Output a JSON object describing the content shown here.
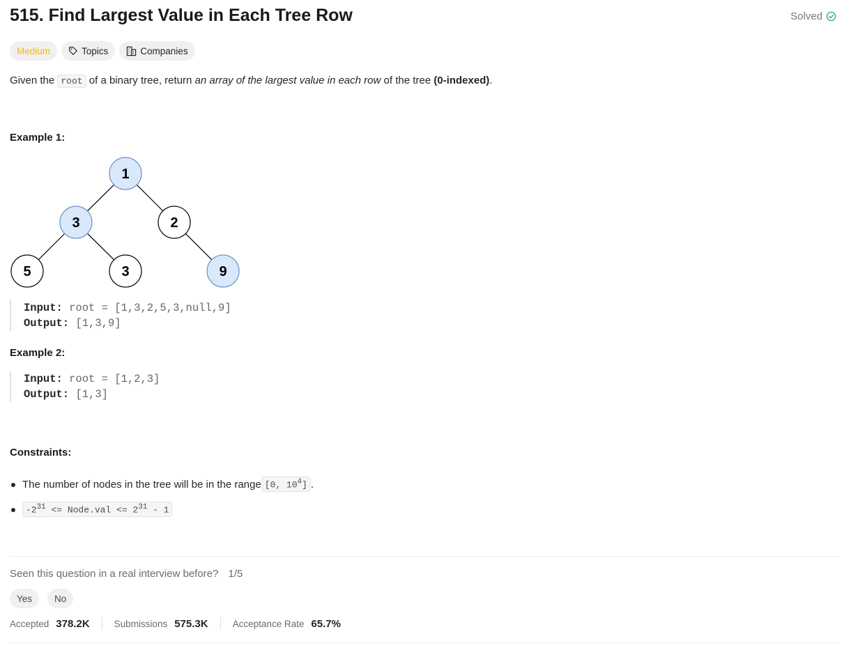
{
  "problem": {
    "title": "515. Find Largest Value in Each Tree Row",
    "status": "Solved",
    "difficulty": "Medium",
    "topics_label": "Topics",
    "companies_label": "Companies"
  },
  "description": {
    "part1": "Given the ",
    "code": "root",
    "part2": " of a binary tree, return ",
    "emphasis": "an array of the largest value in each row",
    "part3": " of the tree ",
    "strong": "(0-indexed)",
    "part4": "."
  },
  "example1": {
    "heading": "Example 1:",
    "input_label": "Input:",
    "input_value": "root = [1,3,2,5,3,null,9]",
    "output_label": "Output:",
    "output_value": "[1,3,9]",
    "tree": {
      "nodes": [
        {
          "label": "1",
          "highlighted": true
        },
        {
          "label": "3",
          "highlighted": true
        },
        {
          "label": "2",
          "highlighted": false
        },
        {
          "label": "5",
          "highlighted": false
        },
        {
          "label": "3",
          "highlighted": false
        },
        {
          "label": "9",
          "highlighted": true
        }
      ],
      "highlight_color": "#dae8fc",
      "highlight_border": "#6c8ebf"
    }
  },
  "example2": {
    "heading": "Example 2:",
    "input_label": "Input:",
    "input_value": "root = [1,2,3]",
    "output_label": "Output:",
    "output_value": "[1,3]"
  },
  "constraints": {
    "heading": "Constraints:",
    "item1_text": "The number of nodes in the tree will be in the range ",
    "item1_code_a": "[0, 10",
    "item1_code_sup": "4",
    "item1_code_b": "]",
    "item1_end": ".",
    "item2_a": "-2",
    "item2_sup1": "31",
    "item2_b": " <= Node.val <= 2",
    "item2_sup2": "31",
    "item2_c": " - 1"
  },
  "feedback": {
    "question": "Seen this question in a real interview before?",
    "ratio": "1/5",
    "yes": "Yes",
    "no": "No"
  },
  "stats": {
    "accepted_label": "Accepted",
    "accepted_value": "378.2K",
    "submissions_label": "Submissions",
    "submissions_value": "575.3K",
    "rate_label": "Acceptance Rate",
    "rate_value": "65.7%"
  },
  "colors": {
    "medium": "#ffb800",
    "solved_icon": "#2db55d"
  }
}
